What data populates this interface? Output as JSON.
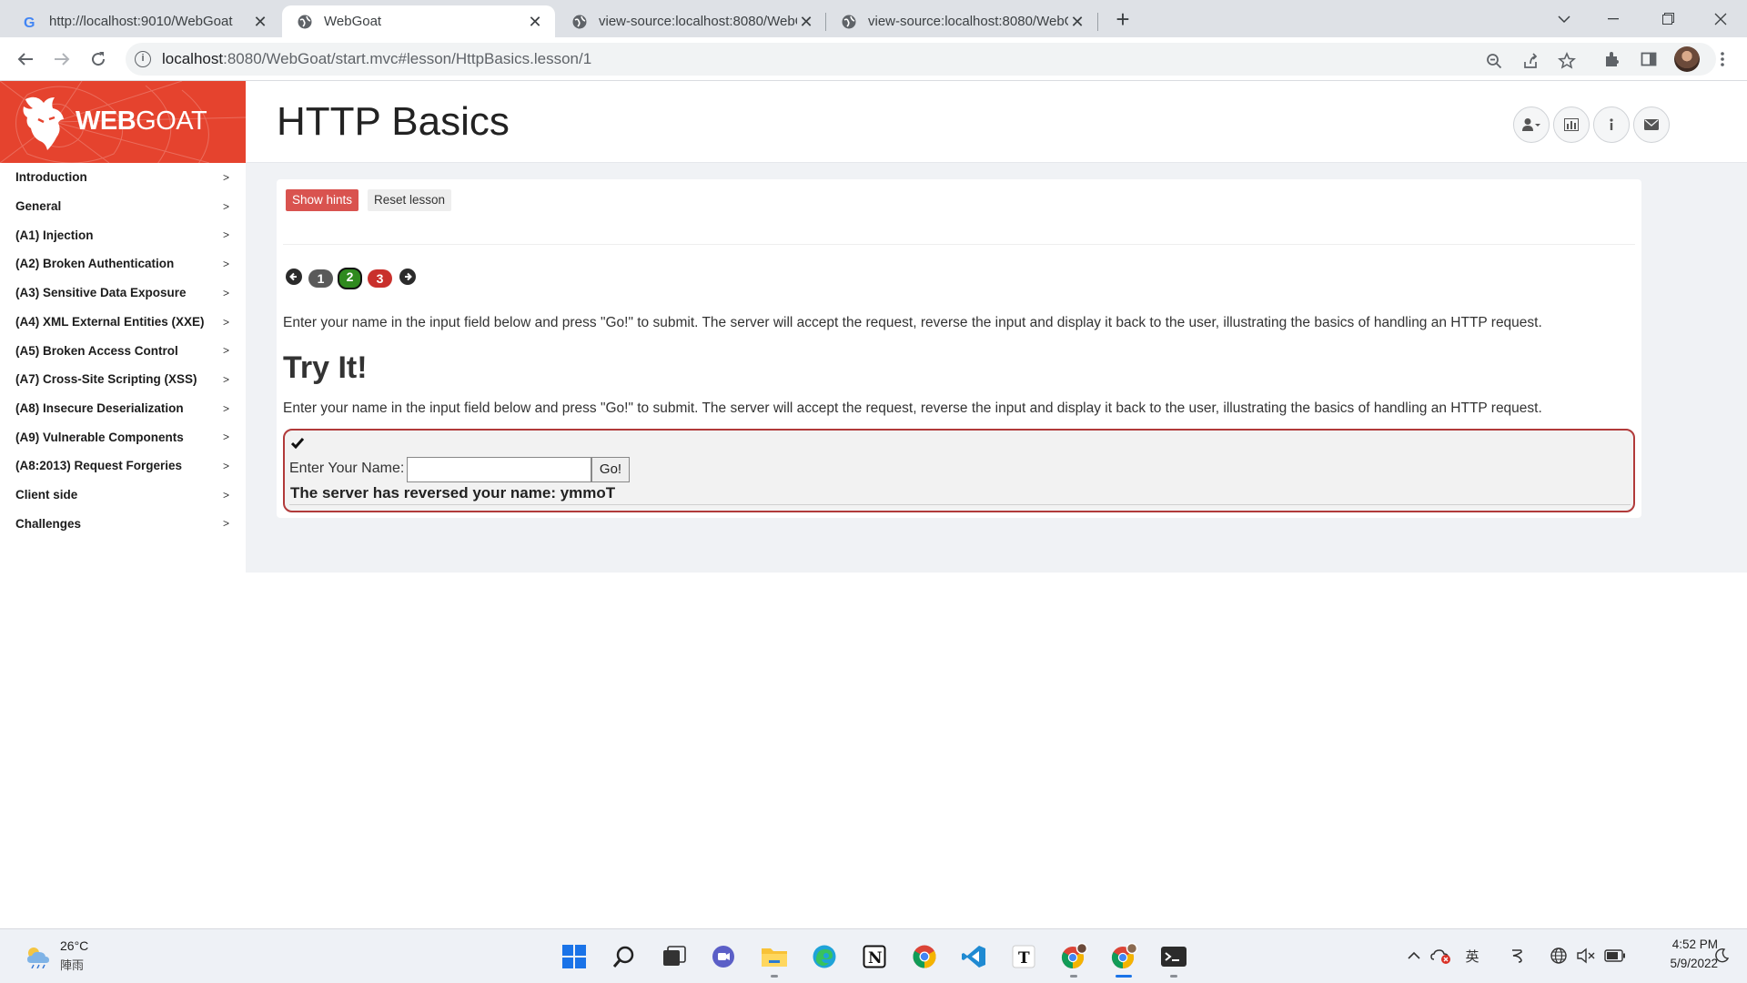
{
  "browser": {
    "tabs": [
      {
        "title": "http://localhost:9010/WebGoat"
      },
      {
        "title": "WebGoat"
      },
      {
        "title": "view-source:localhost:8080/WebG"
      },
      {
        "title": "view-source:localhost:8080/WebG"
      }
    ],
    "close_glyph": "✕",
    "newtab_glyph": "+",
    "url_host": "localhost",
    "url_rest": ":8080/WebGoat/start.mvc#lesson/HttpBasics.lesson/1"
  },
  "app": {
    "logo_bold": "WEB",
    "logo_light": "GOAT",
    "page_title": "HTTP Basics",
    "accent_color": "#e5432e"
  },
  "sidebar": {
    "items": [
      {
        "label": "Introduction"
      },
      {
        "label": "General"
      },
      {
        "label": "(A1) Injection"
      },
      {
        "label": "(A2) Broken Authentication"
      },
      {
        "label": "(A3) Sensitive Data Exposure"
      },
      {
        "label": "(A4) XML External Entities (XXE)"
      },
      {
        "label": "(A5) Broken Access Control"
      },
      {
        "label": "(A7) Cross-Site Scripting (XSS)"
      },
      {
        "label": "(A8) Insecure Deserialization"
      },
      {
        "label": "(A9) Vulnerable Components"
      },
      {
        "label": "(A8:2013) Request Forgeries"
      },
      {
        "label": "Client side"
      },
      {
        "label": "Challenges"
      }
    ]
  },
  "lesson": {
    "show_hints": "Show hints",
    "reset_lesson": "Reset lesson",
    "pages": [
      "1",
      "2",
      "3"
    ],
    "intro_text": "Enter your name in the input field below and press \"Go!\" to submit. The server will accept the request, reverse the input and display it back to the user, illustrating the basics of handling an HTTP request.",
    "try_title": "Try It!",
    "try_text": "Enter your name in the input field below and press \"Go!\" to submit. The server will accept the request, reverse the input and display it back to the user, illustrating the basics of handling an HTTP request.",
    "form": {
      "name_label": "Enter Your Name:",
      "name_value": "",
      "go_label": "Go!"
    },
    "result": "The server has reversed your name: ymmoT"
  },
  "taskbar": {
    "temperature": "26°C",
    "weather": "陣雨",
    "ime": "英",
    "time": "4:52 PM",
    "date": "5/9/2022"
  }
}
